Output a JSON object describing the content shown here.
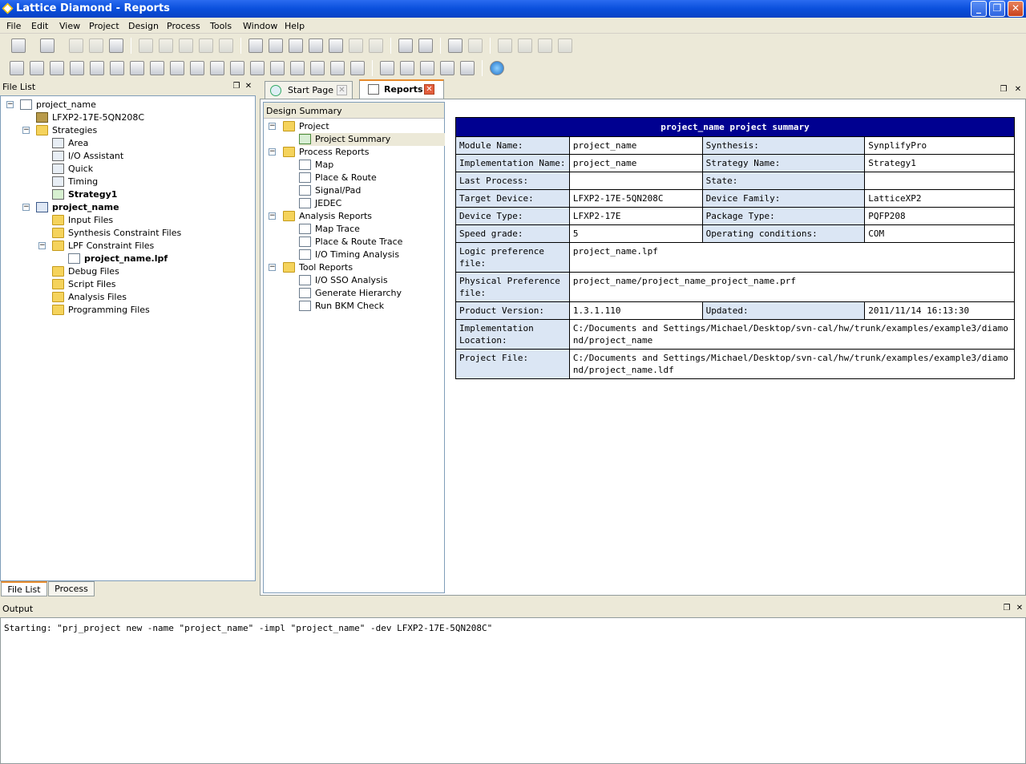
{
  "window": {
    "title": "Lattice Diamond - Reports"
  },
  "menu": [
    "File",
    "Edit",
    "View",
    "Project",
    "Design",
    "Process",
    "Tools",
    "Window",
    "Help"
  ],
  "file_list": {
    "title": "File List",
    "nodes": [
      {
        "label": "project_name",
        "bold": false
      },
      {
        "label": "LFXP2-17E-5QN208C",
        "bold": false
      },
      {
        "label": "Strategies",
        "bold": false
      },
      {
        "label": "Area",
        "bold": false
      },
      {
        "label": "I/O Assistant",
        "bold": false
      },
      {
        "label": "Quick",
        "bold": false
      },
      {
        "label": "Timing",
        "bold": false
      },
      {
        "label": "Strategy1",
        "bold": true
      },
      {
        "label": "project_name",
        "bold": true
      },
      {
        "label": "Input Files",
        "bold": false
      },
      {
        "label": "Synthesis Constraint Files",
        "bold": false
      },
      {
        "label": "LPF Constraint Files",
        "bold": false
      },
      {
        "label": "project_name.lpf",
        "bold": true
      },
      {
        "label": "Debug Files",
        "bold": false
      },
      {
        "label": "Script Files",
        "bold": false
      },
      {
        "label": "Analysis Files",
        "bold": false
      },
      {
        "label": "Programming Files",
        "bold": false
      }
    ],
    "tabs": [
      "File List",
      "Process"
    ]
  },
  "doc_tabs": [
    {
      "label": "Start Page"
    },
    {
      "label": "Reports"
    }
  ],
  "design_summary": {
    "title": "Design Summary",
    "nodes": [
      "Project",
      "Project Summary",
      "Process Reports",
      "Map",
      "Place & Route",
      "Signal/Pad",
      "JEDEC",
      "Analysis Reports",
      "Map Trace",
      "Place & Route Trace",
      "I/O Timing Analysis",
      "Tool Reports",
      "I/O SSO Analysis",
      "Generate Hierarchy",
      "Run BKM Check"
    ]
  },
  "report": {
    "heading": "project_name project summary",
    "module_name_k": "Module Name:",
    "module_name_v": "project_name",
    "synthesis_k": "Synthesis:",
    "synthesis_v": "SynplifyPro",
    "impl_name_k": "Implementation Name:",
    "impl_name_v": "project_name",
    "strategy_k": "Strategy Name:",
    "strategy_v": "Strategy1",
    "last_process_k": "Last Process:",
    "last_process_v": "",
    "state_k": "State:",
    "state_v": "",
    "target_device_k": "Target Device:",
    "target_device_v": "LFXP2-17E-5QN208C",
    "device_family_k": "Device Family:",
    "device_family_v": "LatticeXP2",
    "device_type_k": "Device Type:",
    "device_type_v": "LFXP2-17E",
    "package_type_k": "Package Type:",
    "package_type_v": "PQFP208",
    "speed_grade_k": "Speed grade:",
    "speed_grade_v": "5",
    "operating_k": "Operating conditions:",
    "operating_v": "COM",
    "logic_pref_k": "Logic preference file:",
    "logic_pref_v": "project_name.lpf",
    "phys_pref_k": "Physical Preference file:",
    "phys_pref_v": "project_name/project_name_project_name.prf",
    "product_version_k": "Product Version:",
    "product_version_v": "1.3.1.110",
    "updated_k": "Updated:",
    "updated_v": "2011/11/14 16:13:30",
    "impl_location_k": "Implementation Location:",
    "impl_location_v": "C:/Documents and Settings/Michael/Desktop/svn-cal/hw/trunk/examples/example3/diamond/project_name",
    "project_file_k": "Project File:",
    "project_file_v": "C:/Documents and Settings/Michael/Desktop/svn-cal/hw/trunk/examples/example3/diamond/project_name.ldf"
  },
  "output": {
    "title": "Output",
    "text": "Starting: \"prj_project new -name \"project_name\" -impl \"project_name\" -dev LFXP2-17E-5QN208C\""
  },
  "colors": {
    "title_bar": "#0a4fdc",
    "report_header": "#000090",
    "key_cell": "#dbe6f4",
    "active_tab": "#e68b2c"
  }
}
